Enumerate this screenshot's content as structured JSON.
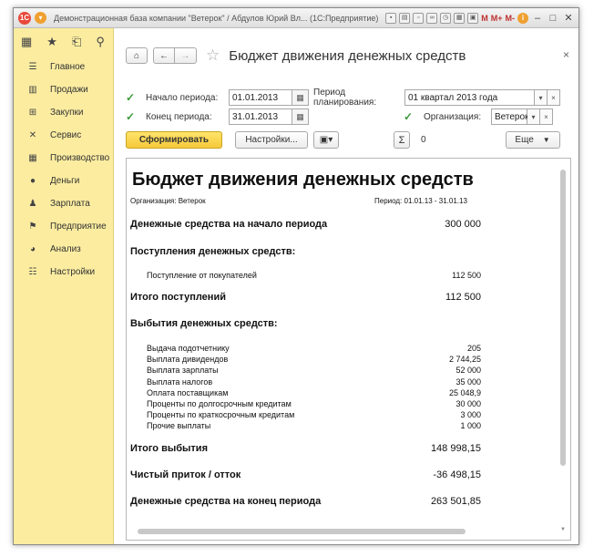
{
  "titlebar": {
    "title": "Демонстрационная база компании \"Ветерок\" / Абдулов Юрий Вл... (1С:Предприятие)",
    "m": "M",
    "mplus": "M+",
    "mminus": "M-"
  },
  "sidebar": {
    "items": [
      {
        "label": "Главное",
        "icon": "☰"
      },
      {
        "label": "Продажи",
        "icon": "▥"
      },
      {
        "label": "Закупки",
        "icon": "⊞"
      },
      {
        "label": "Сервис",
        "icon": "✕"
      },
      {
        "label": "Производство",
        "icon": "▦"
      },
      {
        "label": "Деньги",
        "icon": "●"
      },
      {
        "label": "Зарплата",
        "icon": "♟"
      },
      {
        "label": "Предприятие",
        "icon": "⚑"
      },
      {
        "label": "Анализ",
        "icon": "◕"
      },
      {
        "label": "Настройки",
        "icon": "☷"
      }
    ]
  },
  "form": {
    "title": "Бюджет движения денежных средств",
    "period_start_label": "Начало периода:",
    "period_start_value": "01.01.2013",
    "planning_period_label": "Период планирования:",
    "planning_period_value": "01 квартал 2013 года",
    "period_end_label": "Конец периода:",
    "period_end_value": "31.01.2013",
    "organization_label": "Организация:",
    "organization_value": "Ветерок",
    "generate_label": "Сформировать",
    "settings_label": "Настройки...",
    "sum_label": "Σ",
    "sum_value": "0",
    "more_label": "Еще"
  },
  "report": {
    "title": "Бюджет движения денежных средств",
    "organization_line": "Организация: Ветерок",
    "period_line": "Период: 01.01.13 - 31.01.13",
    "opening_label": "Денежные средства на начало периода",
    "opening_value": "300 000",
    "receipts_header": "Поступления денежных средств:",
    "receipts": [
      {
        "label": "Поступление от покупателей",
        "value": "112 500"
      }
    ],
    "receipts_total_label": "Итого поступлений",
    "receipts_total_value": "112 500",
    "payments_header": "Выбытия денежных средств:",
    "payments": [
      {
        "label": "Выдача подотчетнику",
        "value": "205"
      },
      {
        "label": "Выплата дивидендов",
        "value": "2 744,25"
      },
      {
        "label": "Выплата зарплаты",
        "value": "52 000"
      },
      {
        "label": "Выплата налогов",
        "value": "35 000"
      },
      {
        "label": "Оплата поставщикам",
        "value": "25 048,9"
      },
      {
        "label": "Проценты по долгосрочным кредитам",
        "value": "30 000"
      },
      {
        "label": "Проценты по краткосрочным кредитам",
        "value": "3 000"
      },
      {
        "label": "Прочие выплаты",
        "value": "1 000"
      }
    ],
    "payments_total_label": "Итого выбытия",
    "payments_total_value": "148 998,15",
    "net_label": "Чистый приток / отток",
    "net_value": "-36 498,15",
    "closing_label": "Денежные средства на конец периода",
    "closing_value": "263 501,85"
  }
}
